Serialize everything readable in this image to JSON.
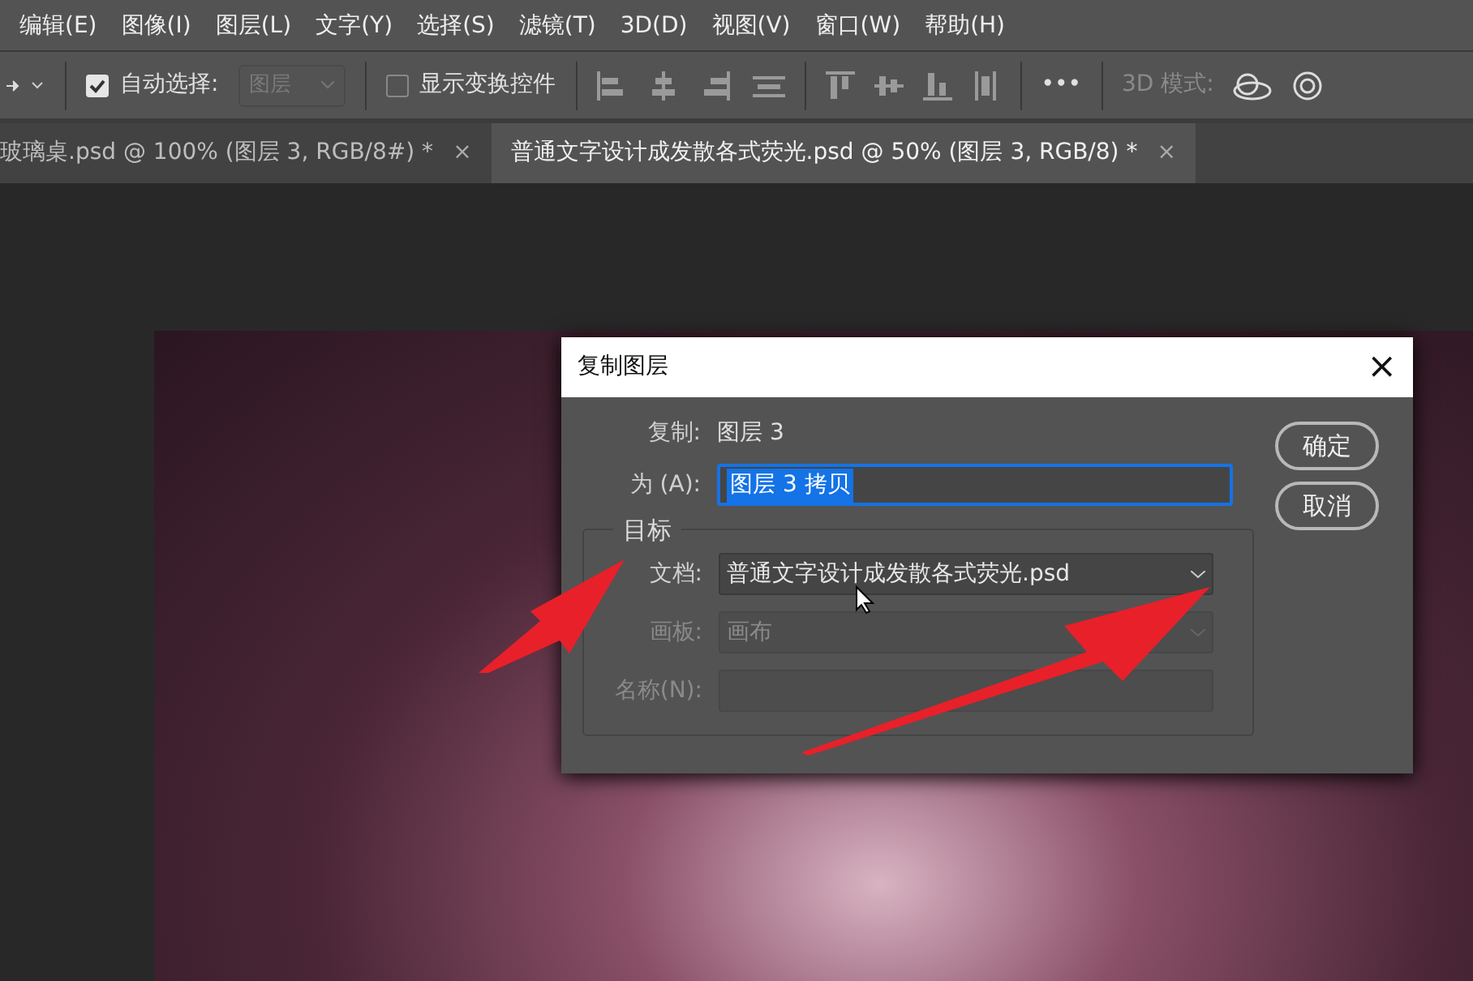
{
  "menu": [
    "编辑(E)",
    "图像(I)",
    "图层(L)",
    "文字(Y)",
    "选择(S)",
    "滤镜(T)",
    "3D(D)",
    "视图(V)",
    "窗口(W)",
    "帮助(H)"
  ],
  "options_bar": {
    "auto_select": {
      "label": "自动选择:",
      "checked": true
    },
    "layer_select": {
      "value": "图层",
      "disabled": true
    },
    "show_transform": {
      "label": "显示变换控件",
      "checked": false
    },
    "more": "•••",
    "mode_3d": {
      "label": "3D 模式:",
      "disabled": true
    }
  },
  "tabs": [
    {
      "label": "玻璃桌.psd @ 100% (图层 3, RGB/8#) *",
      "close": "×",
      "selected": false
    },
    {
      "label": "普通文字设计成发散各式荧光.psd @ 50% (图层 3, RGB/8) *",
      "close": "×",
      "selected": true
    }
  ],
  "dialog": {
    "title": "复制图层",
    "close": "×",
    "source_label": "复制:",
    "source_value": "图层 3",
    "as_label": "为 (A):",
    "as_value": "图层 3 拷贝",
    "as_highlighted": true,
    "group_title": "目标",
    "fields": [
      {
        "kind": "select",
        "label": "文档:",
        "value": "普通文字设计成发散各式荧光.psd",
        "disabled": false
      },
      {
        "kind": "select",
        "label": "画板:",
        "value": "画布",
        "disabled": true
      },
      {
        "kind": "text",
        "label": "名称(N):",
        "disabled": true
      }
    ],
    "buttons": [
      "确定",
      "取消"
    ]
  }
}
